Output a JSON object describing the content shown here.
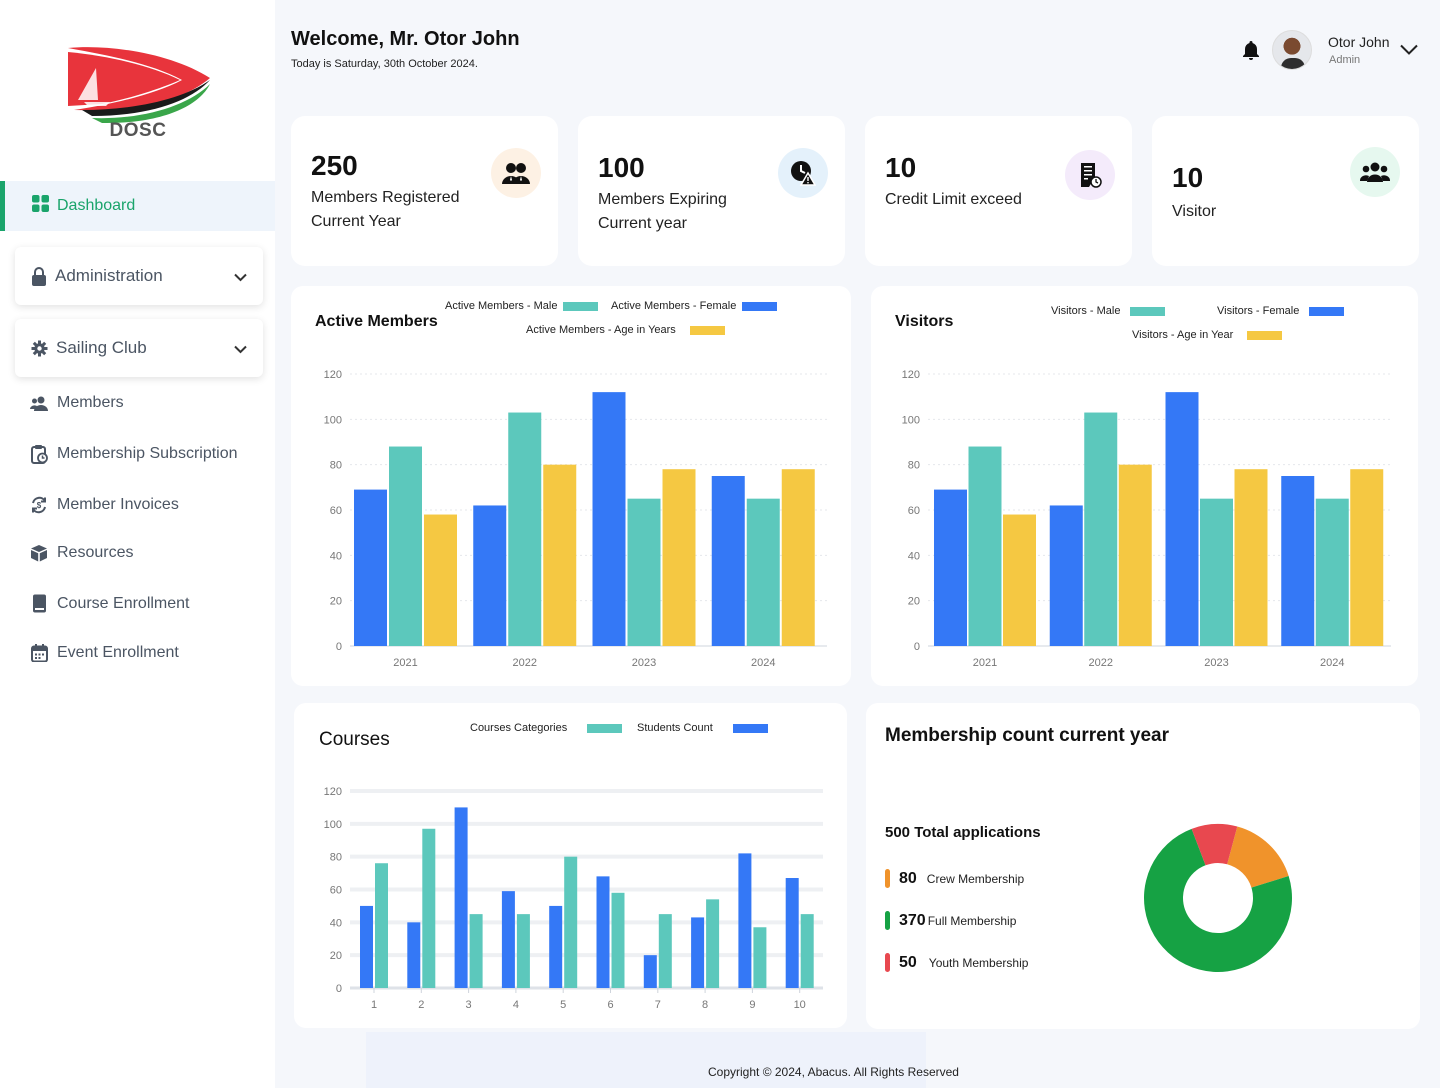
{
  "brand": {
    "name": "DOSC"
  },
  "sidebar": {
    "active": {
      "label": "Dashboard"
    },
    "groups": [
      {
        "label": "Administration"
      },
      {
        "label": "Sailing Club"
      }
    ],
    "items": [
      {
        "label": "Members"
      },
      {
        "label": "Membership Subscription"
      },
      {
        "label": "Member Invoices"
      },
      {
        "label": "Resources"
      },
      {
        "label": "Course Enrollment"
      },
      {
        "label": "Event Enrollment"
      }
    ]
  },
  "header": {
    "welcome": "Welcome, Mr. Otor John",
    "today": "Today is Saturday, 30th October 2024.",
    "user_name": "Otor John",
    "user_role": "Admin"
  },
  "stats": [
    {
      "value": "250",
      "label": "Members Registered Current Year",
      "icon": "members-icon",
      "color": "#fdf1e4"
    },
    {
      "value": "100",
      "label": "Members Expiring Current year",
      "icon": "clock-warning-icon",
      "color": "#e4f1fb"
    },
    {
      "value": "10",
      "label": "Credit Limit exceed",
      "icon": "invoice-icon",
      "color": "#f4ebfb"
    },
    {
      "value": "10",
      "label": "Visitor",
      "icon": "visitors-icon",
      "color": "#e6f8ef"
    }
  ],
  "colors": {
    "blue": "#3478f6",
    "teal": "#5cc8bc",
    "yellow": "#f5c842",
    "green": "#16a244",
    "orange": "#f0932b",
    "red": "#e8484f",
    "accent": "#1aa46b"
  },
  "chart_data": [
    {
      "type": "bar",
      "title": "Active Members",
      "categories": [
        "2021",
        "2022",
        "2023",
        "2024"
      ],
      "ylim": [
        0,
        120
      ],
      "yticks": [
        0,
        20,
        40,
        60,
        80,
        100,
        120
      ],
      "series": [
        {
          "name": "Active Members - Female",
          "color": "#3478f6",
          "values": [
            69,
            62,
            112,
            75
          ]
        },
        {
          "name": "Active Members - Male",
          "color": "#5cc8bc",
          "values": [
            88,
            103,
            65,
            65
          ]
        },
        {
          "name": "Active Members - Age in Years",
          "color": "#f5c842",
          "values": [
            58,
            80,
            78,
            78
          ]
        }
      ]
    },
    {
      "type": "bar",
      "title": "Visitors",
      "categories": [
        "2021",
        "2022",
        "2023",
        "2024"
      ],
      "ylim": [
        0,
        120
      ],
      "yticks": [
        0,
        20,
        40,
        60,
        80,
        100,
        120
      ],
      "series": [
        {
          "name": "Visitors - Female",
          "color": "#3478f6",
          "values": [
            69,
            62,
            112,
            75
          ]
        },
        {
          "name": "Visitors - Male",
          "color": "#5cc8bc",
          "values": [
            88,
            103,
            65,
            65
          ]
        },
        {
          "name": "Visitors - Age in Year",
          "color": "#f5c842",
          "values": [
            58,
            80,
            78,
            78
          ]
        }
      ]
    },
    {
      "type": "bar",
      "title": "Courses",
      "categories": [
        "1",
        "2",
        "3",
        "4",
        "5",
        "6",
        "7",
        "8",
        "9",
        "10"
      ],
      "ylim": [
        0,
        120
      ],
      "yticks": [
        0,
        20,
        40,
        60,
        80,
        100,
        120
      ],
      "series": [
        {
          "name": "Students Count",
          "color": "#3478f6",
          "values": [
            50,
            40,
            110,
            59,
            50,
            68,
            20,
            43,
            82,
            67
          ]
        },
        {
          "name": "Courses Categories",
          "color": "#5cc8bc",
          "values": [
            76,
            97,
            45,
            45,
            80,
            58,
            45,
            54,
            37,
            45
          ]
        }
      ]
    },
    {
      "type": "pie",
      "title": "Membership count current year",
      "total_label": "500 Total applications",
      "slices": [
        {
          "name": "Crew Membership",
          "value": 80,
          "color": "#f0932b"
        },
        {
          "name": "Full Membership",
          "value": 370,
          "color": "#16a244"
        },
        {
          "name": "Youth Membership",
          "value": 50,
          "color": "#e8484f"
        }
      ]
    }
  ],
  "footer": {
    "text": "Copyright  © 2024, Abacus. All Rights Reserved"
  }
}
